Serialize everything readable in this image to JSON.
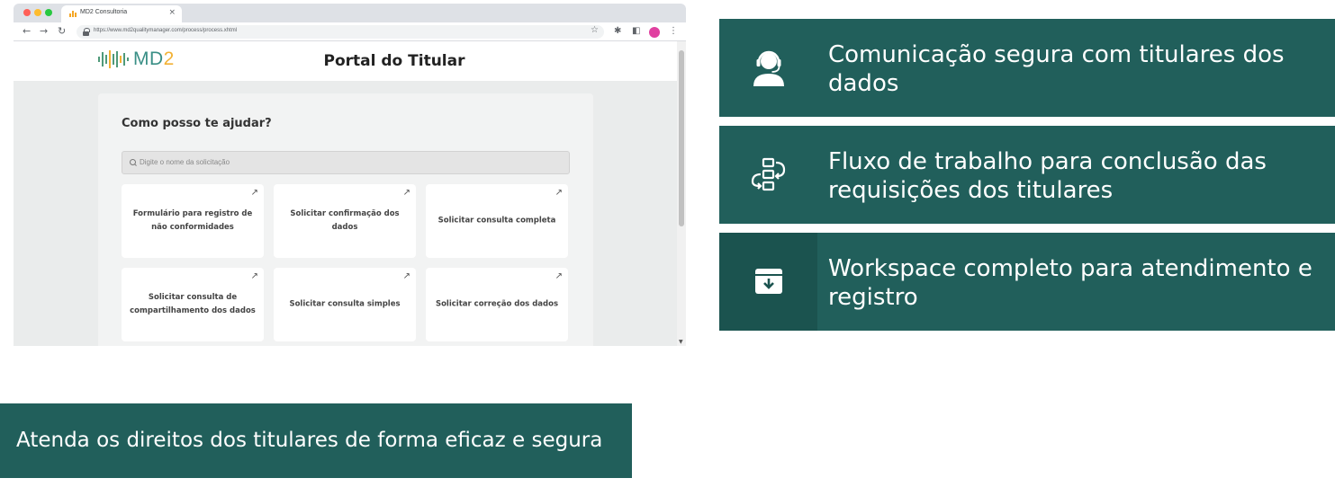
{
  "browser": {
    "tab_title": "MD2 Consultoria",
    "tab_close": "×",
    "url": "https://www.md2qualitymanager.com/process/process.xhtml",
    "nav": {
      "back": "←",
      "forward": "→",
      "reload": "↻"
    },
    "toolbar_icons": {
      "star": "☆",
      "extensions": "✱",
      "sidepanel": "◧",
      "menu": "⋮"
    }
  },
  "site": {
    "logo_text_a": "MD",
    "logo_text_b": "2",
    "portal_title": "Portal do Titular",
    "help_title": "Como posso te ajudar?",
    "search_placeholder": "Digite o nome da solicitação",
    "card_arrow": "↗",
    "cards": [
      {
        "label": "Formulário para registro de não conformidades"
      },
      {
        "label": "Solicitar confirmação dos dados"
      },
      {
        "label": "Solicitar consulta completa"
      },
      {
        "label": "Solicitar consulta de compartilhamento dos dados"
      },
      {
        "label": "Solicitar consulta simples"
      },
      {
        "label": "Solicitar correção dos dados"
      }
    ]
  },
  "features": [
    {
      "icon": "headset-user-icon",
      "text": "Comunicação segura com titulares dos dados"
    },
    {
      "icon": "workflow-icon",
      "text": "Fluxo de trabalho para conclusão das requisições dos titulares"
    },
    {
      "icon": "archive-box-icon",
      "text": "Workspace completo para atendimento e registro"
    }
  ],
  "banner": {
    "text": "Atenda os direitos dos titulares de forma eficaz e segura"
  },
  "colors": {
    "teal": "#215f5b",
    "teal_dark": "#1b534f",
    "logo_teal": "#3a8f86",
    "logo_yellow": "#f2b134"
  }
}
